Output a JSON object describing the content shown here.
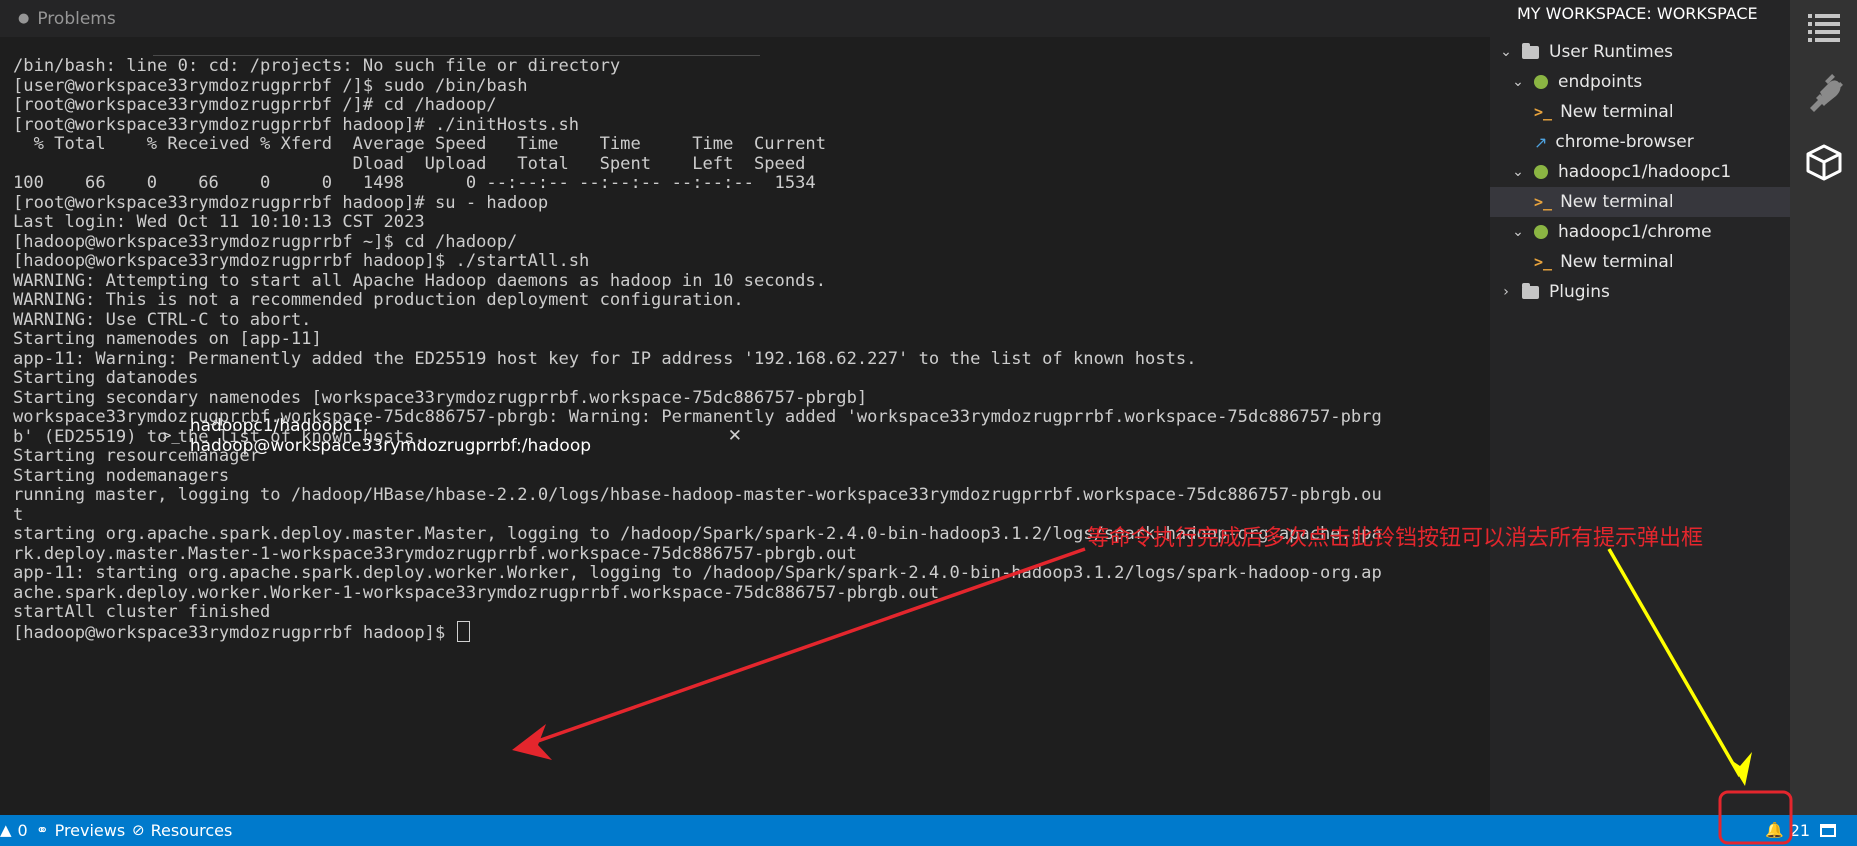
{
  "tabs": {
    "problems": "Problems",
    "terminal": "hadoopc1/hadoopc1: hadoop@workspace33rymdozrugprrbf:/hadoop"
  },
  "terminal": {
    "lines": [
      "/bin/bash: line 0: cd: /projects: No such file or directory",
      "[user@workspace33rymdozrugprrbf /]$ sudo /bin/bash",
      "[root@workspace33rymdozrugprrbf /]# cd /hadoop/",
      "[root@workspace33rymdozrugprrbf hadoop]# ./initHosts.sh",
      "  % Total    % Received % Xferd  Average Speed   Time    Time     Time  Current",
      "                                 Dload  Upload   Total   Spent    Left  Speed",
      "100    66    0    66    0     0   1498      0 --:--:-- --:--:-- --:--:--  1534",
      "[root@workspace33rymdozrugprrbf hadoop]# su - hadoop",
      "Last login: Wed Oct 11 10:10:13 CST 2023",
      "[hadoop@workspace33rymdozrugprrbf ~]$ cd /hadoop/",
      "[hadoop@workspace33rymdozrugprrbf hadoop]$ ./startAll.sh",
      "WARNING: Attempting to start all Apache Hadoop daemons as hadoop in 10 seconds.",
      "WARNING: This is not a recommended production deployment configuration.",
      "WARNING: Use CTRL-C to abort.",
      "Starting namenodes on [app-11]",
      "app-11: Warning: Permanently added the ED25519 host key for IP address '192.168.62.227' to the list of known hosts.",
      "Starting datanodes",
      "Starting secondary namenodes [workspace33rymdozrugprrbf.workspace-75dc886757-pbrgb]",
      "workspace33rymdozrugprrbf.workspace-75dc886757-pbrgb: Warning: Permanently added 'workspace33rymdozrugprrbf.workspace-75dc886757-pbrg",
      "b' (ED25519) to the list of known hosts.",
      "Starting resourcemanager",
      "Starting nodemanagers",
      "running master, logging to /hadoop/HBase/hbase-2.2.0/logs/hbase-hadoop-master-workspace33rymdozrugprrbf.workspace-75dc886757-pbrgb.ou",
      "t",
      "starting org.apache.spark.deploy.master.Master, logging to /hadoop/Spark/spark-2.4.0-bin-hadoop3.1.2/logs/spark-hadoop-org.apache.spa",
      "rk.deploy.master.Master-1-workspace33rymdozrugprrbf.workspace-75dc886757-pbrgb.out",
      "app-11: starting org.apache.spark.deploy.worker.Worker, logging to /hadoop/Spark/spark-2.4.0-bin-hadoop3.1.2/logs/spark-hadoop-org.ap",
      "ache.spark.deploy.worker.Worker-1-workspace33rymdozrugprrbf.workspace-75dc886757-pbrgb.out",
      "startAll cluster finished"
    ],
    "prompt": "[hadoop@workspace33rymdozrugprrbf hadoop]$"
  },
  "explorer": {
    "title": "MY WORKSPACE: WORKSPACE",
    "items": [
      {
        "label": "User Runtimes"
      },
      {
        "label": "endpoints"
      },
      {
        "label": "New terminal"
      },
      {
        "label": "chrome-browser"
      },
      {
        "label": "hadoopc1/hadoopc1"
      },
      {
        "label": "New terminal"
      },
      {
        "label": "hadoopc1/chrome"
      },
      {
        "label": "New terminal"
      },
      {
        "label": "Plugins"
      }
    ]
  },
  "statusbar": {
    "problems_count": "0",
    "previews": "Previews",
    "resources": "Resources",
    "notification_count": "21"
  },
  "annotation": {
    "text": "等命令执行完成后多次点击此铃铛按钮可以消去所有提示弹出框"
  },
  "colors": {
    "accent": "#007acc",
    "annotation_red": "#e4262d",
    "annotation_yellow": "#ffff00",
    "runtime_dot": "#8bb543"
  }
}
